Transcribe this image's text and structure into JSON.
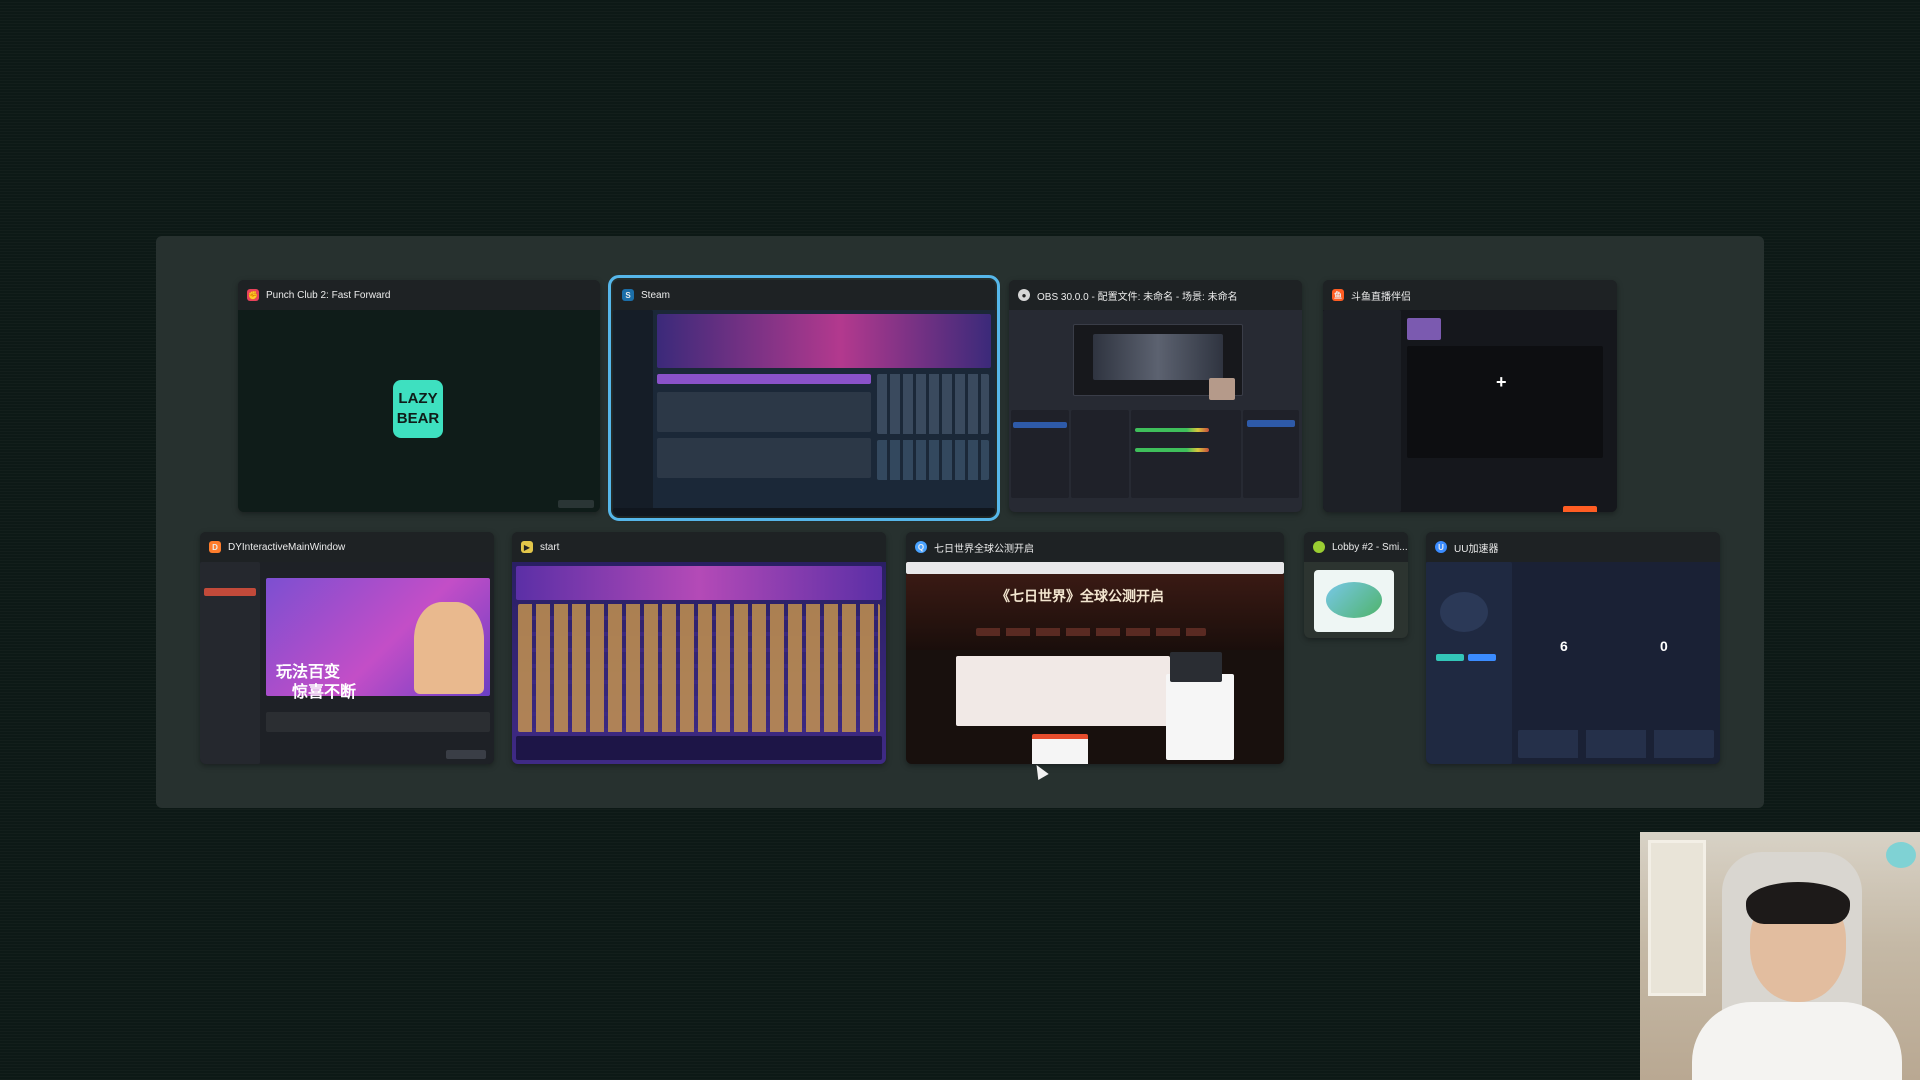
{
  "windows": [
    {
      "title": "Punch Club 2: Fast Forward",
      "icon": "punch-club-icon",
      "accent": "#e8425b",
      "logo_text": "LAZY BEAR"
    },
    {
      "title": "Steam",
      "icon": "steam-icon",
      "accent": "#1b6ea8",
      "focused": true
    },
    {
      "title": "OBS 30.0.0 - 配置文件: 未命名 - 场景: 未命名",
      "icon": "obs-icon",
      "accent": "#d6d6d6"
    },
    {
      "title": "斗鱼直播伴侣",
      "icon": "douyu-icon",
      "accent": "#ff5d23"
    },
    {
      "title": "DYInteractiveMainWindow",
      "icon": "douyu-interactive-icon",
      "accent": "#ff7d2c",
      "banner_line1": "玩法百变",
      "banner_line2": "惊喜不断"
    },
    {
      "title": "start",
      "icon": "start-icon",
      "accent": "#e2c64a"
    },
    {
      "title": "七日世界全球公测开启",
      "icon": "browser-icon",
      "accent": "#4aa3ff",
      "headline": "《七日世界》全球公测开启"
    },
    {
      "title": "Lobby #2 - Smi...",
      "icon": "lobby-icon",
      "accent": "#9acd32"
    },
    {
      "title": "UU加速器",
      "icon": "uu-icon",
      "accent": "#3b8cff",
      "stats": [
        "6",
        "0"
      ]
    }
  ],
  "colors": {
    "background": "#0d1916",
    "panel": "#27312f",
    "focus_ring": "#56b7ea"
  }
}
